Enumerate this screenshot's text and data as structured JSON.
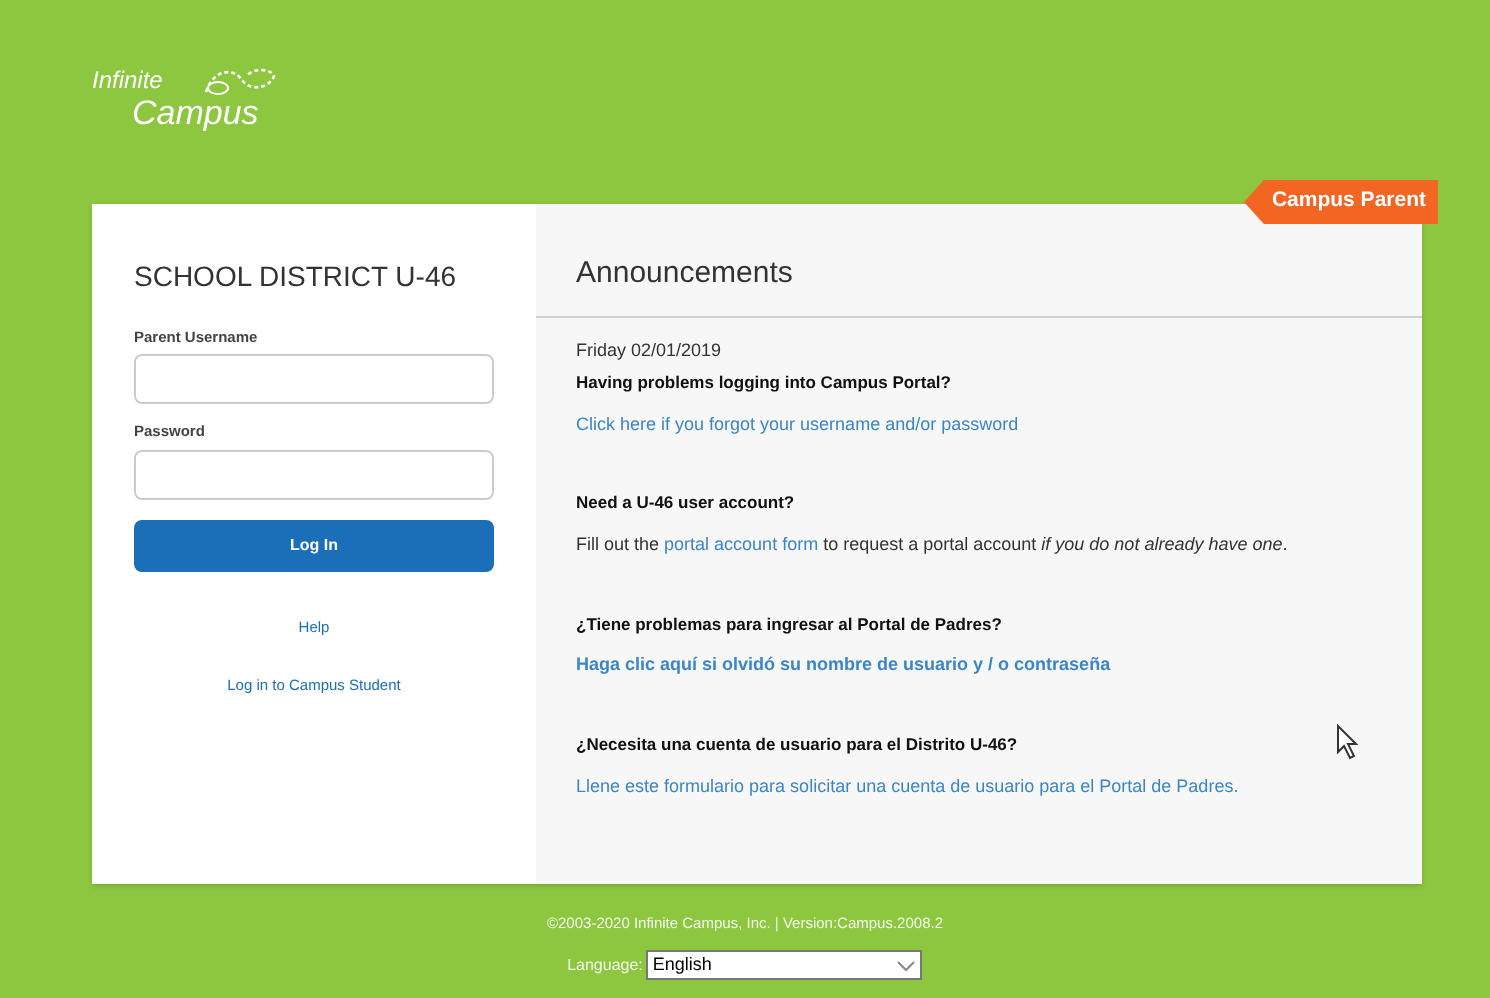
{
  "logo": {
    "line_1": "Infinite",
    "line_2": "Campus"
  },
  "ribbon": "Campus Parent",
  "login": {
    "district": "SCHOOL DISTRICT U-46",
    "fields": [
      {
        "label": "Parent Username"
      },
      {
        "label": "Password"
      }
    ],
    "button": "Log In",
    "links": [
      "Help",
      "Log in to Campus Student"
    ]
  },
  "announcements": {
    "title": "Announcements",
    "items": [
      {
        "date": "Friday 02/01/2019",
        "heading": "Having problems logging into Campus Portal?",
        "body": [
          {
            "kind": "link",
            "text": "Click here if you forgot your username and/or password"
          }
        ]
      },
      {
        "heading": "Need a U-46 user account?",
        "body": [
          {
            "kind": "text",
            "text": "Fill out the "
          },
          {
            "kind": "link",
            "text": "portal account form"
          },
          {
            "kind": "text",
            "text": " to request a portal account *if you do not already have one*."
          }
        ]
      },
      {
        "heading": "¿Tiene problemas para ingresar al Portal de Padres?",
        "body": [
          {
            "kind": "boldlink",
            "text": "Haga clic aquí si olvidó su nombre de usuario y / o contraseña"
          }
        ]
      },
      {
        "heading": "¿Necesita una cuenta de usuario para el Distrito U-46?",
        "body": [
          {
            "kind": "link",
            "text": "Llene este formulario para solicitar una cuenta de usuario para el Portal de Padres."
          }
        ]
      }
    ]
  },
  "footer": {
    "copyright": "©2003-2020 Infinite Campus, Inc. | Version:Campus.2008.2",
    "language_label": "Language:",
    "language": "English"
  }
}
